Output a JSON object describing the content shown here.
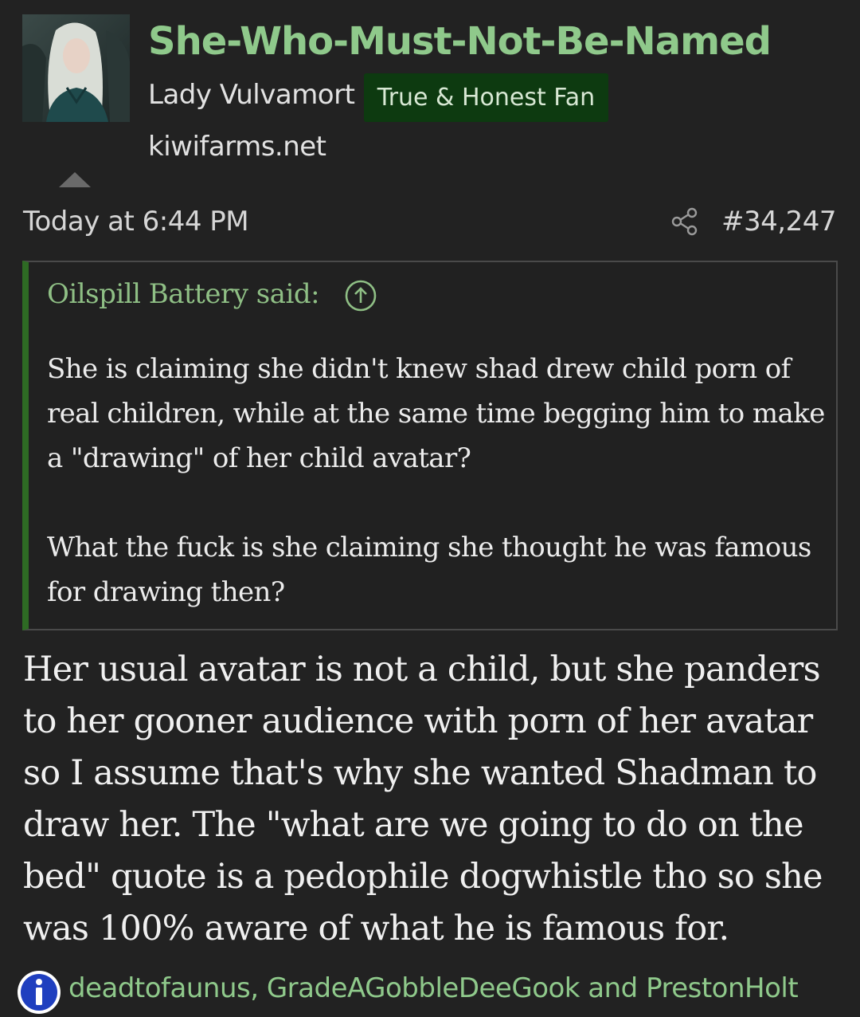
{
  "user": {
    "name": "She-Who-Must-Not-Be-Named",
    "title": "Lady Vulvamort",
    "banner": "True & Honest Fan",
    "site": "kiwifarms.net"
  },
  "post": {
    "date": "Today at 6:44 PM",
    "number": "#34,247"
  },
  "quote": {
    "attribution": "Oilspill Battery said:",
    "paragraphs": [
      "She is claiming she didn't knew shad drew child porn of real children, while at the same time begging him to make a \"drawing\" of her child avatar?",
      "What the fuck is she claiming she thought he was famous for drawing then?"
    ]
  },
  "body": "Her usual avatar is not a child, but she panders to her gooner audience with porn of her avatar so I assume that's why she wanted Shadman to draw her. The \"what are we going to do on the bed\" quote is a pedophile dogwhistle tho so she was 100% aware of what he is famous for.",
  "reactions": {
    "users": "deadtofaunus, GradeAGobbleDeeGook and PrestonHolt"
  },
  "colors": {
    "background": "#222222",
    "username": "#8fc98b",
    "banner_bg": "#0d3a10",
    "quote_border": "#2e6b24",
    "info_icon": "#1f3fbf"
  }
}
